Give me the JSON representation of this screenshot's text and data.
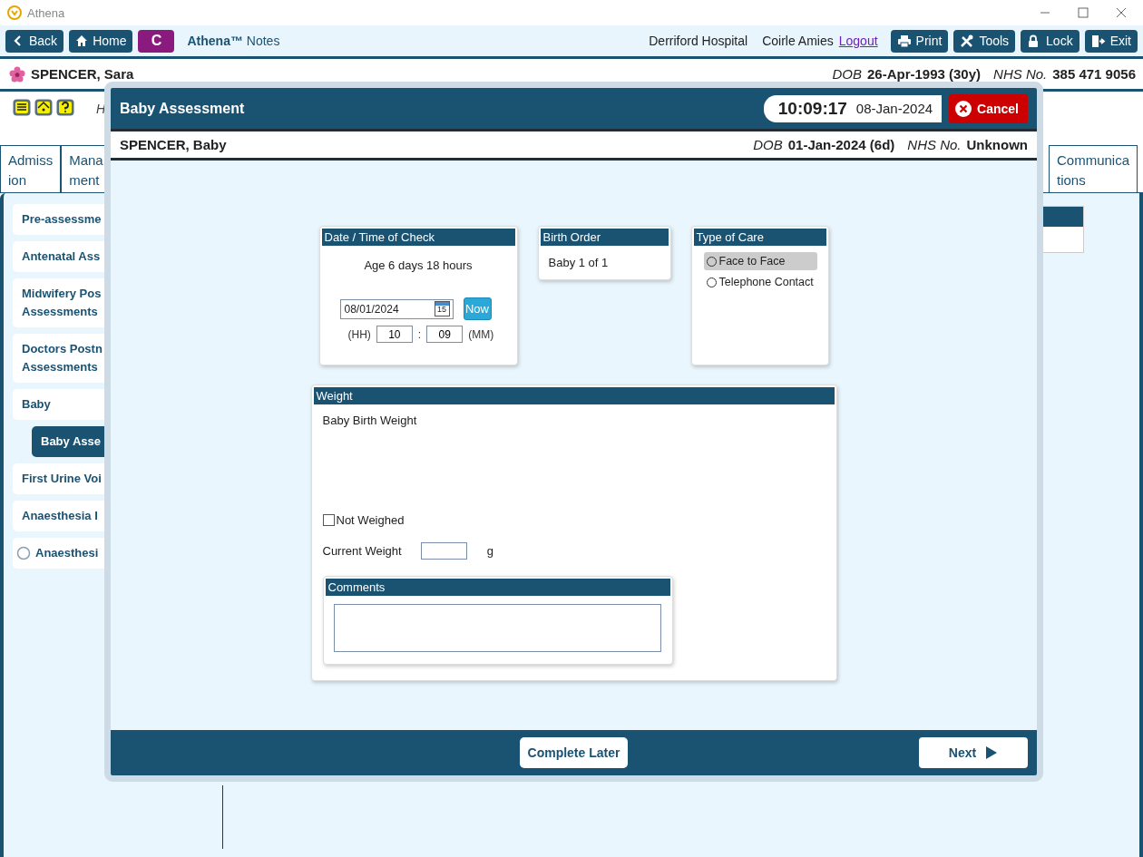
{
  "window": {
    "title": "Athena"
  },
  "toolbar": {
    "nav": [
      {
        "kind": "back",
        "label": "Back"
      },
      {
        "kind": "home",
        "label": "Home"
      },
      {
        "kind": "letter",
        "label": "C"
      }
    ],
    "app_name": "**Athena™** Notes",
    "location": "Derriford Hospital",
    "user": "Coirle Amies",
    "logout": "Logout",
    "actions": [
      {
        "kind": "print",
        "label": "Print"
      },
      {
        "kind": "tools",
        "label": "Tools"
      },
      {
        "kind": "lock",
        "label": "Lock"
      },
      {
        "kind": "exit",
        "label": "Exit"
      }
    ]
  },
  "patient": {
    "name": "SPENCER, Sara",
    "dob_label": "DOB",
    "dob": "26-Apr-1993 (30y)",
    "nhs_label": "NHS No.",
    "nhs": "385 471 9056"
  },
  "hint": "H",
  "tabs": [
    {
      "lines": [
        "Admiss",
        "ion"
      ]
    },
    {
      "lines": [
        "Mana",
        "ment"
      ]
    },
    {
      "lines": [
        "Communica",
        "tions"
      ]
    }
  ],
  "sidebar": {
    "items": [
      {
        "kind": "link",
        "label": "Pre-assessme",
        "selected": false
      },
      {
        "kind": "link",
        "label": "Antenatal Ass",
        "selected": false
      },
      {
        "kind": "link",
        "label": "Midwifery Pos\nAssessments",
        "selected": false
      },
      {
        "kind": "link",
        "label": "Doctors Postn\nAssessments",
        "selected": false
      },
      {
        "kind": "link",
        "label": "Baby",
        "selected": false,
        "children": [
          {
            "label": "Baby Asse",
            "selected": true
          }
        ]
      },
      {
        "kind": "link",
        "label": "First Urine Voi",
        "selected": false
      },
      {
        "kind": "link",
        "label": "Anaesthesia I",
        "selected": false
      },
      {
        "kind": "radio",
        "label": "Anaesthesi",
        "selected": false
      }
    ]
  },
  "modal": {
    "title": "Baby Assessment",
    "time": "10:09:17",
    "date": "08-Jan-2024",
    "cancel": "Cancel",
    "baby": {
      "name": "SPENCER, Baby",
      "dob_label": "DOB",
      "dob": "01-Jan-2024 (6d)",
      "nhs_label": "NHS No.",
      "nhs": "Unknown"
    },
    "date_check": {
      "title": "Date / Time of Check",
      "age": "Age 6 days 18 hours",
      "date": "08/01/2024",
      "calendar_day": "15",
      "now": "Now",
      "hh_label": "(HH)",
      "hh": "10",
      "separator": ":",
      "mm": "09",
      "mm_label": "(MM)"
    },
    "birth_order": {
      "title": "Birth Order",
      "text": "Baby 1 of 1"
    },
    "type_of_care": {
      "title": "Type of Care",
      "options": [
        {
          "label": "Face to Face",
          "selected": false,
          "highlighted": true
        },
        {
          "label": "Telephone Contact",
          "selected": false,
          "highlighted": false
        }
      ]
    },
    "weight": {
      "title": "Weight",
      "birth_weight_label": "Baby Birth Weight",
      "not_weighed": {
        "label": "Not Weighed",
        "checked": false
      },
      "current_label": "Current Weight",
      "unit": "g",
      "comments_title": "Comments"
    },
    "footer": {
      "complete_later": "Complete Later",
      "next": "Next"
    }
  }
}
